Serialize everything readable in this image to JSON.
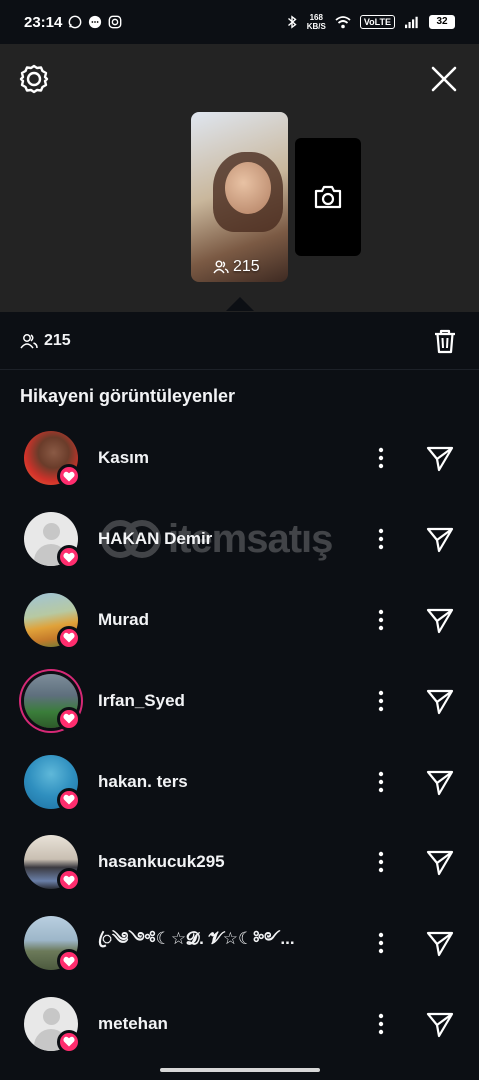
{
  "status_bar": {
    "time": "23:14",
    "net_speed_top": "168",
    "net_speed_unit": "KB/S",
    "volte": "VoLTE",
    "battery": "32"
  },
  "story": {
    "view_count": "215"
  },
  "views_row": {
    "count": "215"
  },
  "section_title": "Hikayeni görüntüleyenler",
  "viewers": [
    {
      "name": "Kasım",
      "avatar": "photo-red"
    },
    {
      "name": "HAKAN Demir",
      "avatar": "default"
    },
    {
      "name": "Murad",
      "avatar": "photo-beach"
    },
    {
      "name": "Irfan_Syed",
      "avatar": "photo-selfie",
      "has_story_ring": true
    },
    {
      "name": "hakan. ters",
      "avatar": "photo-sea"
    },
    {
      "name": "hasankucuk295",
      "avatar": "photo-mirror"
    },
    {
      "name": "ꦿ༄༺☾☆𝓓. 𝓥☆☾༻...",
      "avatar": "photo-group"
    },
    {
      "name": "metehan",
      "avatar": "default"
    }
  ],
  "watermark": {
    "text": "itemsatış"
  },
  "colors": {
    "background": "#0c0f14",
    "top_panel": "#232323",
    "heart_badge": "#ff2d6e",
    "story_ring": "#d62976"
  },
  "icons": [
    "settings-icon",
    "close-icon",
    "camera-icon",
    "viewers-icon",
    "trash-icon",
    "more-icon",
    "send-icon",
    "heart-icon"
  ]
}
